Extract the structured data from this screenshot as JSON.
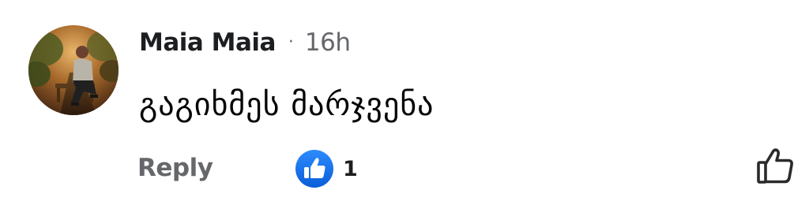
{
  "comment": {
    "author": "Maia Maia",
    "separator": "·",
    "timestamp": "16h",
    "text": "გაგიხმეს მარჯვენა"
  },
  "actions": {
    "reply_label": "Reply",
    "reaction_count": "1"
  },
  "colors": {
    "like_blue": "#1877f2",
    "secondary_text": "#65676b",
    "primary_text": "#050505"
  },
  "icons": {
    "reaction": "thumbs-up-icon",
    "like_action": "thumbs-up-outline-icon"
  }
}
